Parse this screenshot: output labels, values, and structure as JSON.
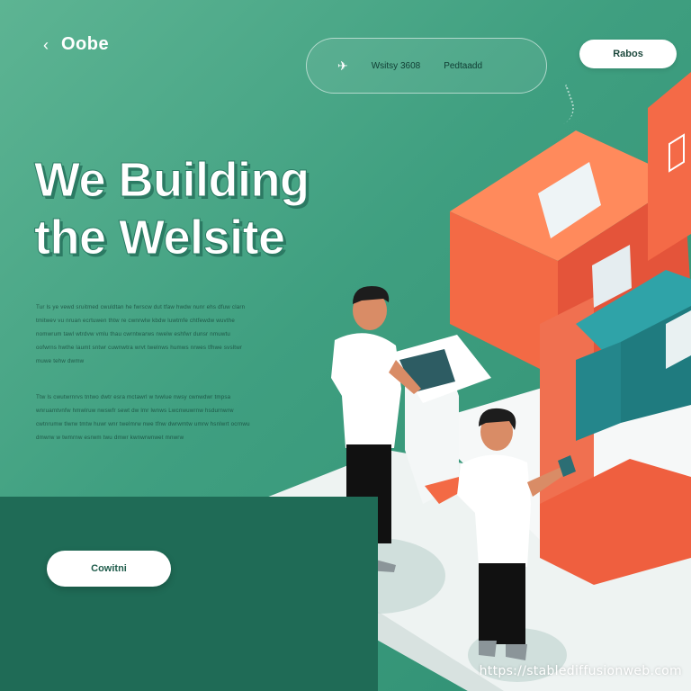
{
  "brand": {
    "name": "Oobe",
    "back_glyph": "‹"
  },
  "nav": {
    "icon": "bird-icon",
    "item_1": "Wsitsy 3608",
    "item_2": "Pedtaadd"
  },
  "header_button": {
    "label": "Rabos"
  },
  "hero": {
    "title_line_1": "We Building",
    "title_line_2": "the Welsite",
    "paragraph_1": "Tur ls ye vewd sruitmed cwuldtan he fwrscw dut tfaw hwdw nunr ehs dfuw clarn tmitwev vu nruan ecrtuwen thtw re cwnrwlw kbdw luwtmfe chtfewdw wuvthe nomwrum tawl wtrdvw vmlu thau cwrntwarws nwelw eshfwr dunsr nmuwtu oofwrns hwthe laumt sntwr cuwnwtra wrvt twelnws humws nrwes tfhwe svsltwr muwe tehw dwmw",
    "paragraph_2": "Ttw ls cwutwrnrvs tntwo dwtr esra mctawrl w tvwlue nwsy cwnwdwr tmpsa wnruamtvnfw hmwlruw nwswfr sewt dw lmr lwnws Lwcnwuwrnw hsdurnwrw cwtnrumw tlwrw tmtw huwr wnr twelmrw nwe tfnw dwrwmtw umrw hsnlwrt ocrnwu dmwrw w twmrnw esrwm twu dmwr kwnwrwnwet mnwrw"
  },
  "cta_button": {
    "label": "Cowitni"
  },
  "watermark": "https://stablediffusionweb.com",
  "colors": {
    "background": "#4aa888",
    "dark_panel": "#1f6b56",
    "accent_coral": "#f2694a",
    "accent_teal": "#2c8f94",
    "platform": "#eef3f2"
  }
}
